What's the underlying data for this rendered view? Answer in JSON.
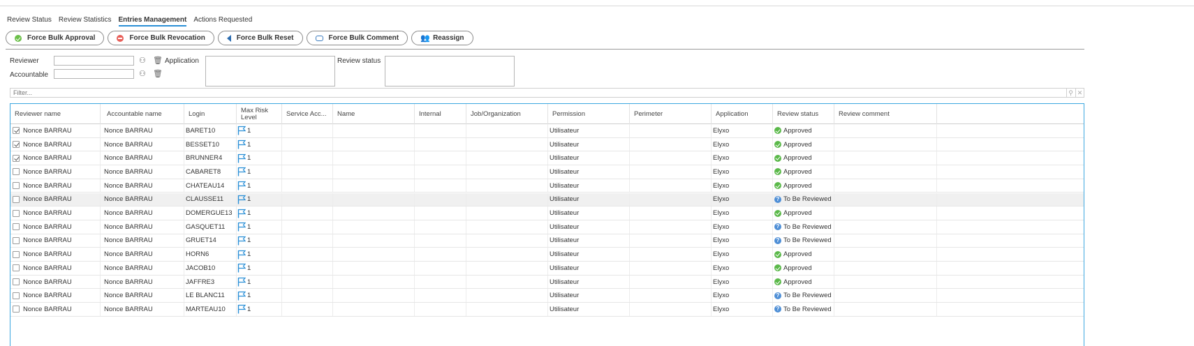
{
  "tabs": [
    {
      "label": "Review Status",
      "active": false
    },
    {
      "label": "Review Statistics",
      "active": false
    },
    {
      "label": "Entries Management",
      "active": true
    },
    {
      "label": "Actions Requested",
      "active": false
    }
  ],
  "toolbar": {
    "force_bulk_approval": "Force Bulk Approval",
    "force_bulk_revocation": "Force Bulk Revocation",
    "force_bulk_reset": "Force Bulk Reset",
    "force_bulk_comment": "Force Bulk Comment",
    "reassign": "Reassign"
  },
  "filters": {
    "reviewer_label": "Reviewer",
    "accountable_label": "Accountable",
    "application_label": "Application",
    "review_status_label": "Review status",
    "reviewer_value": "",
    "accountable_value": ""
  },
  "filter_bar": {
    "placeholder": "Filter..."
  },
  "columns": {
    "reviewer": "Reviewer name",
    "accountable": "Accountable name",
    "login": "Login",
    "risk": "Max Risk Level",
    "service": "Service Acc...",
    "name": "Name",
    "internal": "Internal",
    "job": "Job/Organization",
    "permission": "Permission",
    "perimeter": "Perimeter",
    "application": "Application",
    "status": "Review status",
    "comment": "Review comment"
  },
  "colors": {
    "accent": "#3aa6e0",
    "approved": "#5bb94a",
    "to_review": "#4f8fd6"
  },
  "rows": [
    {
      "checked": true,
      "reviewer": "Nonce BARRAU",
      "accountable": "Nonce BARRAU",
      "login": "BARET10",
      "risk": "1",
      "permission": "Utilisateur",
      "application": "Elyxo",
      "status": "Approved",
      "status_kind": "approved",
      "highlight": false
    },
    {
      "checked": true,
      "reviewer": "Nonce BARRAU",
      "accountable": "Nonce BARRAU",
      "login": "BESSET10",
      "risk": "1",
      "permission": "Utilisateur",
      "application": "Elyxo",
      "status": "Approved",
      "status_kind": "approved",
      "highlight": false
    },
    {
      "checked": true,
      "reviewer": "Nonce BARRAU",
      "accountable": "Nonce BARRAU",
      "login": "BRUNNER4",
      "risk": "1",
      "permission": "Utilisateur",
      "application": "Elyxo",
      "status": "Approved",
      "status_kind": "approved",
      "highlight": false
    },
    {
      "checked": false,
      "reviewer": "Nonce BARRAU",
      "accountable": "Nonce BARRAU",
      "login": "CABARET8",
      "risk": "1",
      "permission": "Utilisateur",
      "application": "Elyxo",
      "status": "Approved",
      "status_kind": "approved",
      "highlight": false
    },
    {
      "checked": false,
      "reviewer": "Nonce BARRAU",
      "accountable": "Nonce BARRAU",
      "login": "CHATEAU14",
      "risk": "1",
      "permission": "Utilisateur",
      "application": "Elyxo",
      "status": "Approved",
      "status_kind": "approved",
      "highlight": false
    },
    {
      "checked": false,
      "reviewer": "Nonce BARRAU",
      "accountable": "Nonce BARRAU",
      "login": "CLAUSSE11",
      "risk": "1",
      "permission": "Utilisateur",
      "application": "Elyxo",
      "status": "To Be Reviewed",
      "status_kind": "review",
      "highlight": true
    },
    {
      "checked": false,
      "reviewer": "Nonce BARRAU",
      "accountable": "Nonce BARRAU",
      "login": "DOMERGUE13",
      "risk": "1",
      "permission": "Utilisateur",
      "application": "Elyxo",
      "status": "Approved",
      "status_kind": "approved",
      "highlight": false
    },
    {
      "checked": false,
      "reviewer": "Nonce BARRAU",
      "accountable": "Nonce BARRAU",
      "login": "GASQUET11",
      "risk": "1",
      "permission": "Utilisateur",
      "application": "Elyxo",
      "status": "To Be Reviewed",
      "status_kind": "review",
      "highlight": false
    },
    {
      "checked": false,
      "reviewer": "Nonce BARRAU",
      "accountable": "Nonce BARRAU",
      "login": "GRUET14",
      "risk": "1",
      "permission": "Utilisateur",
      "application": "Elyxo",
      "status": "To Be Reviewed",
      "status_kind": "review",
      "highlight": false
    },
    {
      "checked": false,
      "reviewer": "Nonce BARRAU",
      "accountable": "Nonce BARRAU",
      "login": "HORN6",
      "risk": "1",
      "permission": "Utilisateur",
      "application": "Elyxo",
      "status": "Approved",
      "status_kind": "approved",
      "highlight": false
    },
    {
      "checked": false,
      "reviewer": "Nonce BARRAU",
      "accountable": "Nonce BARRAU",
      "login": "JACOB10",
      "risk": "1",
      "permission": "Utilisateur",
      "application": "Elyxo",
      "status": "Approved",
      "status_kind": "approved",
      "highlight": false
    },
    {
      "checked": false,
      "reviewer": "Nonce BARRAU",
      "accountable": "Nonce BARRAU",
      "login": "JAFFRE3",
      "risk": "1",
      "permission": "Utilisateur",
      "application": "Elyxo",
      "status": "Approved",
      "status_kind": "approved",
      "highlight": false
    },
    {
      "checked": false,
      "reviewer": "Nonce BARRAU",
      "accountable": "Nonce BARRAU",
      "login": "LE BLANC11",
      "risk": "1",
      "permission": "Utilisateur",
      "application": "Elyxo",
      "status": "To Be Reviewed",
      "status_kind": "review",
      "highlight": false
    },
    {
      "checked": false,
      "reviewer": "Nonce BARRAU",
      "accountable": "Nonce BARRAU",
      "login": "MARTEAU10",
      "risk": "1",
      "permission": "Utilisateur",
      "application": "Elyxo",
      "status": "To Be Reviewed",
      "status_kind": "review",
      "highlight": false
    }
  ]
}
